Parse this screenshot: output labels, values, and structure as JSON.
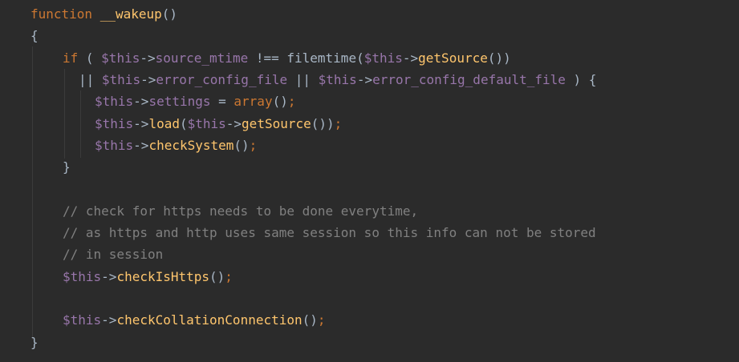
{
  "editor": {
    "language": "php",
    "theme_colors": {
      "background": "#2b2b2b",
      "keyword": "#cc7832",
      "function": "#ffc66d",
      "variable": "#9876aa",
      "comment": "#808080",
      "default": "#a9b7c6"
    },
    "lines": [
      {
        "tokens": [
          [
            "kw",
            "function"
          ],
          [
            "plain",
            " "
          ],
          [
            "fn",
            "__wakeup"
          ],
          [
            "punc",
            "()"
          ]
        ]
      },
      {
        "tokens": [
          [
            "punc",
            "{"
          ]
        ]
      },
      {
        "tokens": [
          [
            "kw",
            "if"
          ],
          [
            "punc",
            " ( "
          ],
          [
            "var",
            "$this"
          ],
          [
            "op",
            "->"
          ],
          [
            "prop",
            "source_mtime"
          ],
          [
            "op",
            " !== "
          ],
          [
            "plain",
            "filemtime"
          ],
          [
            "punc",
            "("
          ],
          [
            "var",
            "$this"
          ],
          [
            "op",
            "->"
          ],
          [
            "fn",
            "getSource"
          ],
          [
            "punc",
            "())"
          ]
        ]
      },
      {
        "tokens": [
          [
            "op",
            "|| "
          ],
          [
            "var",
            "$this"
          ],
          [
            "op",
            "->"
          ],
          [
            "prop",
            "error_config_file"
          ],
          [
            "op",
            " || "
          ],
          [
            "var",
            "$this"
          ],
          [
            "op",
            "->"
          ],
          [
            "prop",
            "error_config_default_file"
          ],
          [
            "punc",
            " ) {"
          ]
        ]
      },
      {
        "tokens": [
          [
            "var",
            "$this"
          ],
          [
            "op",
            "->"
          ],
          [
            "prop",
            "settings"
          ],
          [
            "op",
            " = "
          ],
          [
            "kw",
            "array"
          ],
          [
            "punc",
            "()"
          ],
          [
            "semi",
            ";"
          ]
        ]
      },
      {
        "tokens": [
          [
            "var",
            "$this"
          ],
          [
            "op",
            "->"
          ],
          [
            "fn",
            "load"
          ],
          [
            "punc",
            "("
          ],
          [
            "var",
            "$this"
          ],
          [
            "op",
            "->"
          ],
          [
            "fn",
            "getSource"
          ],
          [
            "punc",
            "())"
          ],
          [
            "semi",
            ";"
          ]
        ]
      },
      {
        "tokens": [
          [
            "var",
            "$this"
          ],
          [
            "op",
            "->"
          ],
          [
            "fn",
            "checkSystem"
          ],
          [
            "punc",
            "()"
          ],
          [
            "semi",
            ";"
          ]
        ]
      },
      {
        "tokens": [
          [
            "punc",
            "}"
          ]
        ]
      },
      {
        "tokens": []
      },
      {
        "tokens": [
          [
            "cmt",
            "// check for https needs to be done everytime,"
          ]
        ]
      },
      {
        "tokens": [
          [
            "cmt",
            "// as https and http uses same session so this info can not be stored"
          ]
        ]
      },
      {
        "tokens": [
          [
            "cmt",
            "// in session"
          ]
        ]
      },
      {
        "tokens": [
          [
            "var",
            "$this"
          ],
          [
            "op",
            "->"
          ],
          [
            "fn",
            "checkIsHttps"
          ],
          [
            "punc",
            "()"
          ],
          [
            "semi",
            ";"
          ]
        ]
      },
      {
        "tokens": []
      },
      {
        "tokens": [
          [
            "var",
            "$this"
          ],
          [
            "op",
            "->"
          ],
          [
            "fn",
            "checkCollationConnection"
          ],
          [
            "punc",
            "()"
          ],
          [
            "semi",
            ";"
          ]
        ]
      },
      {
        "tokens": [
          [
            "punc",
            "}"
          ]
        ]
      }
    ]
  }
}
